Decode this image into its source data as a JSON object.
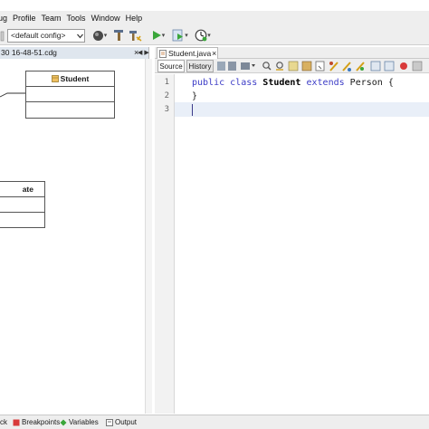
{
  "menubar": {
    "items": [
      "ug",
      "Profile",
      "Team",
      "Tools",
      "Window",
      "Help"
    ]
  },
  "toolbar": {
    "config": "<default config>"
  },
  "diagram_tab": {
    "title": "30 16-48-51.cdg"
  },
  "uml": {
    "student_name": "Student",
    "partial_name": "ate"
  },
  "editor_tab": {
    "title": "Student.java"
  },
  "editor": {
    "sub_tabs": [
      "Source",
      "History"
    ],
    "line_numbers": [
      "1",
      "2",
      "3"
    ],
    "code": {
      "kw_public": "public",
      "kw_class": "class",
      "class_name": "Student",
      "kw_extends": "extends",
      "super_name": "Person",
      "open_brace": "{",
      "close_brace": "}"
    }
  },
  "bottombar": {
    "items": [
      "ck",
      "Breakpoints",
      "Variables",
      "Output"
    ]
  },
  "colors": {
    "keyword": "#3b3bc6",
    "current_line": "#e9eff8",
    "gutter": "#f2f2f2",
    "chrome": "#eeeeee"
  }
}
